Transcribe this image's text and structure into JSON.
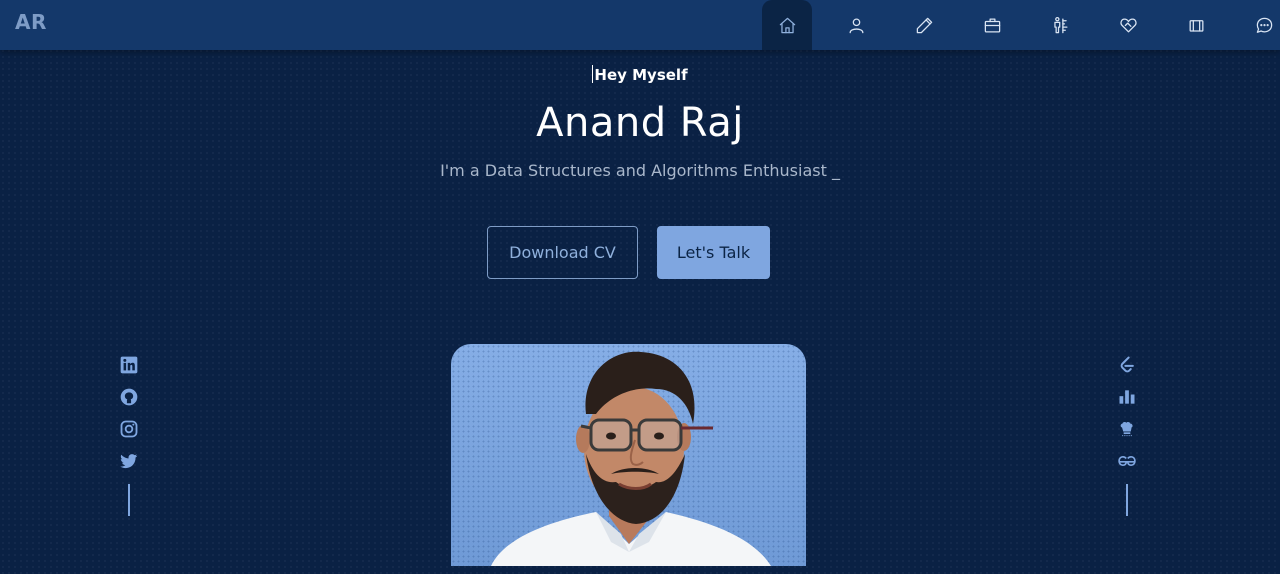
{
  "brand": {
    "logo_text": "AR"
  },
  "nav": {
    "items": [
      {
        "name": "home",
        "icon": "home-icon",
        "active": true
      },
      {
        "name": "about",
        "icon": "user-icon",
        "active": false
      },
      {
        "name": "skills",
        "icon": "pencil-icon",
        "active": false
      },
      {
        "name": "experience",
        "icon": "briefcase-icon",
        "active": false
      },
      {
        "name": "achievements",
        "icon": "person-chart-icon",
        "active": false
      },
      {
        "name": "services",
        "icon": "heart-handshake-icon",
        "active": false
      },
      {
        "name": "portfolio",
        "icon": "folder-icon",
        "active": false
      },
      {
        "name": "contact",
        "icon": "chat-icon",
        "active": false
      }
    ]
  },
  "hero": {
    "greeting": "Hey Myself",
    "name": "Anand Raj",
    "role": "I'm a Data Structures and Algorithms Enthusiast _"
  },
  "buttons": {
    "download_cv": "Download CV",
    "lets_talk": "Let's Talk"
  },
  "social_left": [
    "linkedin-icon",
    "github-icon",
    "instagram-icon",
    "twitter-icon"
  ],
  "social_right": [
    "leetcode-icon",
    "codechef-bars-icon",
    "codechef-chef-icon",
    "geeksforgeeks-icon"
  ],
  "colors": {
    "background": "#0a2144",
    "navbar": "#14386a",
    "accent": "#7fa6e0",
    "muted_text": "#a9b7cb"
  }
}
